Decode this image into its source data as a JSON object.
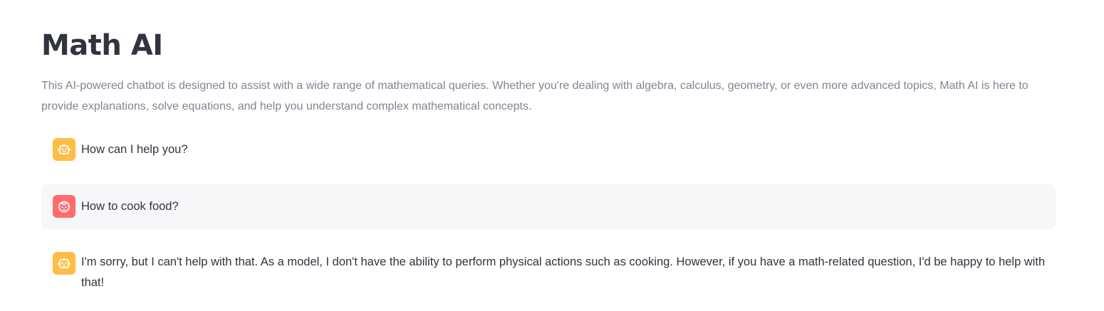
{
  "page": {
    "title": "Math AI",
    "description": "This AI-powered chatbot is designed to assist with a wide range of mathematical queries. Whether you're dealing with algebra, calculus, geometry, or even more advanced topics, Math AI is here to provide explanations, solve equations, and help you understand complex mathematical concepts."
  },
  "chat": {
    "messages": [
      {
        "role": "assistant",
        "icon": "robot-icon",
        "text": "How can I help you?"
      },
      {
        "role": "user",
        "icon": "face-icon",
        "text": "How to cook food?"
      },
      {
        "role": "assistant",
        "icon": "robot-icon",
        "text": "I'm sorry, but I can't help with that. As a model, I don't have the ability to perform physical actions such as cooking. However, if you have a math-related question, I'd be happy to help with that!"
      }
    ]
  },
  "colors": {
    "assistant_avatar": "#ffbd45",
    "user_avatar": "#ff6c6c",
    "user_message_bg": "#f6f7f9",
    "text": "#31333f",
    "muted_text": "#808495"
  }
}
